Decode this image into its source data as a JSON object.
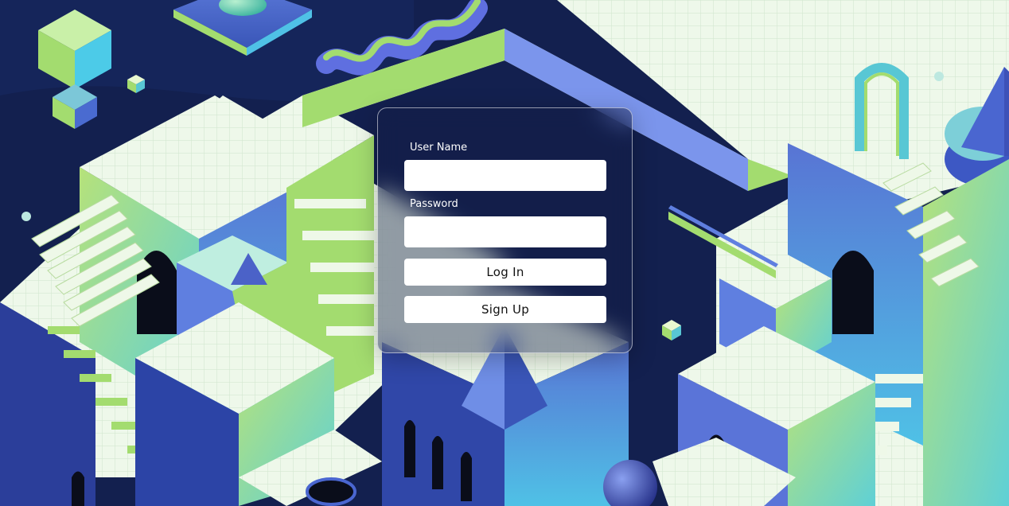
{
  "login": {
    "username_label": "User Name",
    "username_value": "",
    "password_label": "Password",
    "password_value": "",
    "login_label": "Log In",
    "signup_label": "Sign Up"
  },
  "colors": {
    "background_navy": "#12204e",
    "accent_green": "#a3dc6f",
    "accent_blue": "#6f8ee6",
    "tile_white": "#eaf6e6",
    "teal": "#58c7d4"
  }
}
